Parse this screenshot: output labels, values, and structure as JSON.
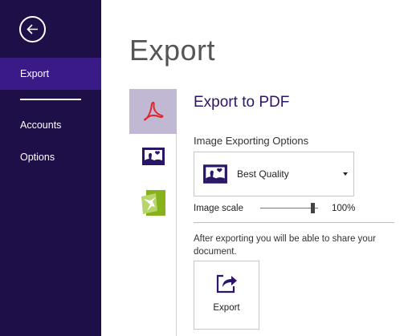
{
  "sidebar": {
    "back_label": "Back",
    "items": [
      {
        "label": "Export",
        "active": true
      },
      {
        "label": "Accounts",
        "active": false
      },
      {
        "label": "Options",
        "active": false
      }
    ]
  },
  "main": {
    "title": "Export",
    "export_types": [
      {
        "icon": "pdf-icon",
        "selected": true
      },
      {
        "icon": "image-icon",
        "selected": false
      },
      {
        "icon": "sway-icon",
        "selected": false
      }
    ],
    "section_title": "Export to PDF",
    "image_options_label": "Image Exporting Options",
    "quality": {
      "value": "Best Quality",
      "icon": "image-icon"
    },
    "image_scale": {
      "label": "Image scale",
      "value_text": "100%",
      "value": 1.0
    },
    "info_text": "After exporting you will be able to share your document.",
    "export_button": {
      "label": "Export",
      "icon": "export-share-icon"
    }
  },
  "colors": {
    "sidebar_bg": "#1f0f48",
    "sidebar_active": "#3a1a86",
    "accent": "#2b1566",
    "selected_type_bg": "#c1b9d3",
    "pdf_red": "#e0262a",
    "sway_green": "#86b21c"
  }
}
